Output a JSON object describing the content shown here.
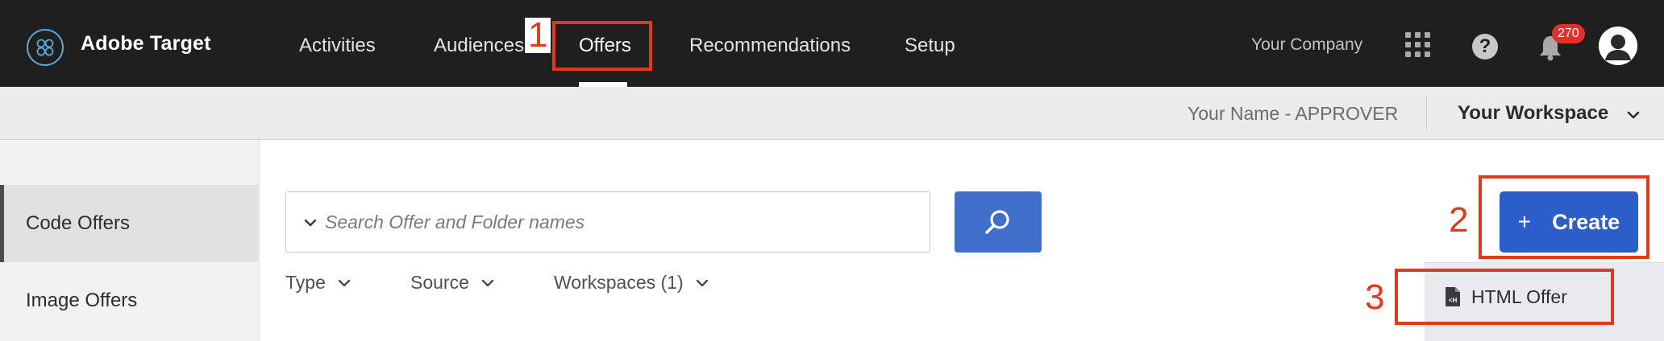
{
  "header": {
    "app_title": "Adobe Target",
    "nav": [
      {
        "label": "Activities"
      },
      {
        "label": "Audiences"
      },
      {
        "label": "Offers",
        "active": true
      },
      {
        "label": "Recommendations"
      },
      {
        "label": "Setup"
      }
    ],
    "company": "Your Company",
    "notification_count": "270",
    "icons": {
      "logo": "adobe-target-logo-icon",
      "apps": "apps-grid-icon",
      "help": "help-icon",
      "notifications": "bell-icon",
      "profile": "avatar-icon"
    },
    "help_glyph": "?"
  },
  "subheader": {
    "user_role": "Your Name - APPROVER",
    "workspace": "Your Workspace"
  },
  "sidebar": {
    "items": [
      {
        "label": "Code Offers",
        "active": true
      },
      {
        "label": "Image Offers"
      }
    ]
  },
  "main": {
    "search_placeholder": "Search Offer and Folder names",
    "filters": [
      {
        "label": "Type"
      },
      {
        "label": "Source"
      },
      {
        "label": "Workspaces (1)"
      }
    ],
    "create_plus": "+",
    "create_label": "Create",
    "menu_items": [
      {
        "label": "HTML Offer",
        "icon": "html-offer-icon"
      }
    ]
  },
  "annotations": [
    "1",
    "2",
    "3"
  ],
  "colors": {
    "topbar_bg": "#1f1f1f",
    "accent_blue": "#2b5ec9",
    "annotation_red": "#e03a1e",
    "badge_red": "#e4302a"
  }
}
